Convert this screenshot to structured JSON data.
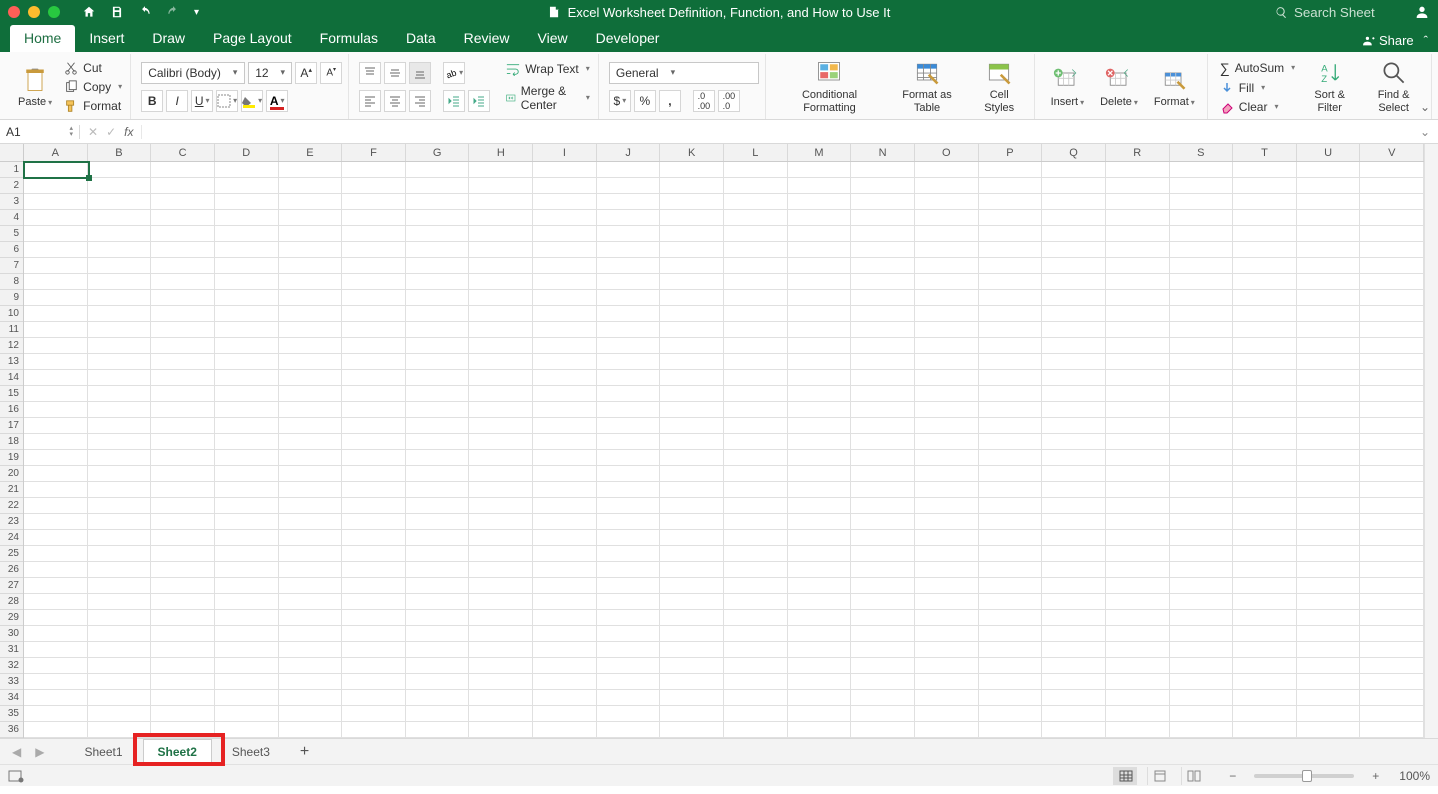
{
  "window": {
    "title": "Excel Worksheet Definition, Function, and How to Use It",
    "search_placeholder": "Search Sheet",
    "share_label": "Share"
  },
  "tabs": [
    "Home",
    "Insert",
    "Draw",
    "Page Layout",
    "Formulas",
    "Data",
    "Review",
    "View",
    "Developer"
  ],
  "active_tab": "Home",
  "ribbon": {
    "paste": "Paste",
    "cut": "Cut",
    "copy": "Copy",
    "format_painter": "Format",
    "font_name": "Calibri (Body)",
    "font_size": "12",
    "wrap": "Wrap Text",
    "merge": "Merge & Center",
    "number_format": "General",
    "cond_fmt": "Conditional Formatting",
    "fmt_table": "Format as Table",
    "cell_styles": "Cell Styles",
    "insert": "Insert",
    "delete": "Delete",
    "format": "Format",
    "autosum": "AutoSum",
    "fill": "Fill",
    "clear": "Clear",
    "sort": "Sort & Filter",
    "find": "Find & Select"
  },
  "formula_bar": {
    "name_box": "A1",
    "formula": ""
  },
  "columns": [
    "A",
    "B",
    "C",
    "D",
    "E",
    "F",
    "G",
    "H",
    "I",
    "J",
    "K",
    "L",
    "M",
    "N",
    "O",
    "P",
    "Q",
    "R",
    "S",
    "T",
    "U",
    "V"
  ],
  "rows": [
    "1",
    "2",
    "3",
    "4",
    "5",
    "6",
    "7",
    "8",
    "9",
    "10",
    "11",
    "12",
    "13",
    "14",
    "15",
    "16",
    "17",
    "18",
    "19",
    "20",
    "21",
    "22",
    "23",
    "24",
    "25",
    "26",
    "27",
    "28",
    "29",
    "30",
    "31",
    "32",
    "33",
    "34",
    "35",
    "36"
  ],
  "sheet_tabs": [
    "Sheet1",
    "Sheet2",
    "Sheet3"
  ],
  "active_sheet": "Sheet2",
  "status": {
    "zoom": "100%"
  }
}
